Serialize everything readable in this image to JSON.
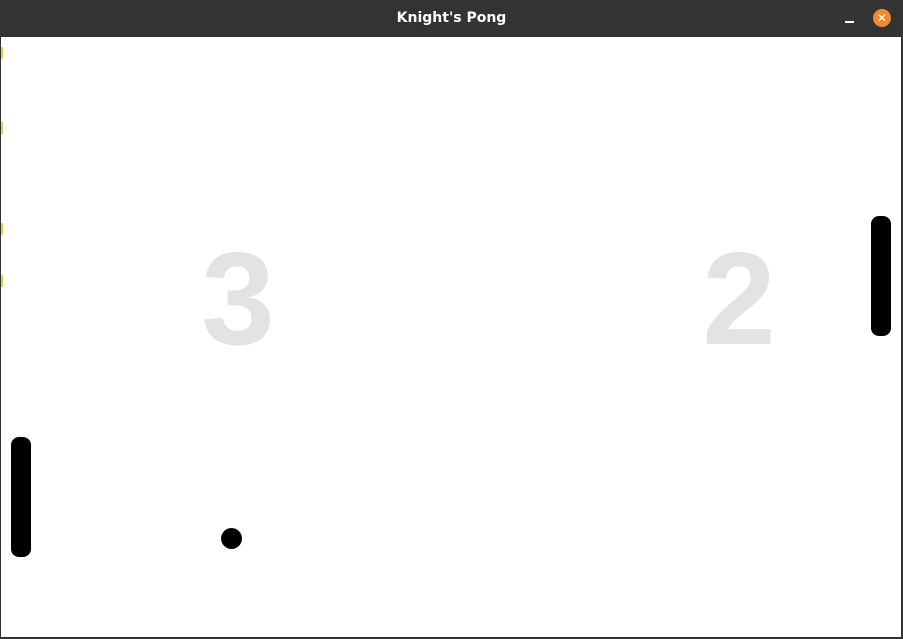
{
  "window": {
    "title": "Knight's Pong",
    "minimize_label": "–",
    "close_label": "✕",
    "close_color": "#ef8a32"
  },
  "game": {
    "background": "#ffffff",
    "score_color": "#e3e3e3",
    "paddle_color": "#000000",
    "ball_color": "#000000",
    "left_score": "3",
    "right_score": "2"
  }
}
